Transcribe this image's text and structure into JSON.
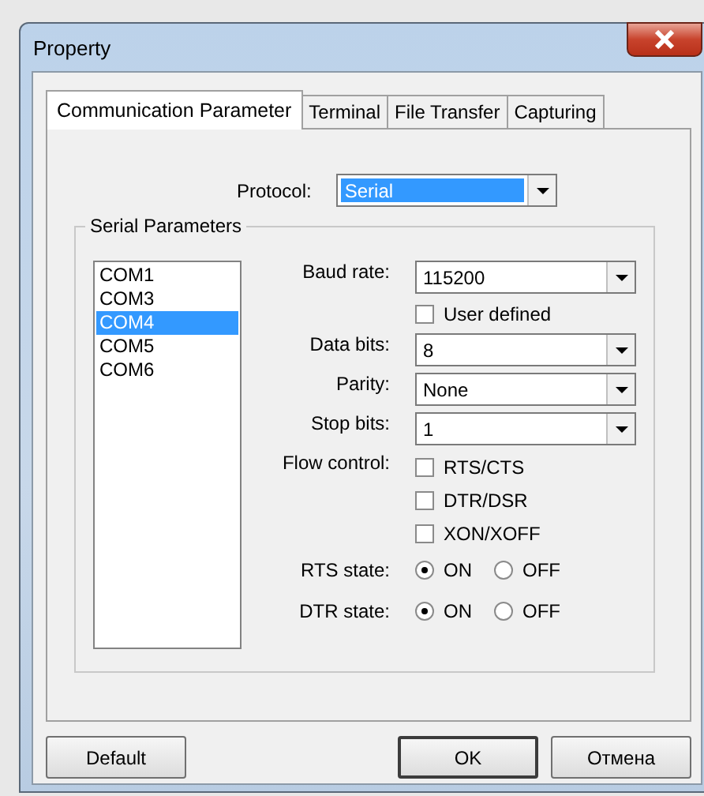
{
  "window": {
    "title": "Property"
  },
  "tabs": [
    {
      "label": "Communication Parameter",
      "selected": true
    },
    {
      "label": "Terminal",
      "selected": false
    },
    {
      "label": "File Transfer",
      "selected": false
    },
    {
      "label": "Capturing",
      "selected": false
    }
  ],
  "protocol": {
    "label": "Protocol:",
    "value": "Serial"
  },
  "serial_parameters": {
    "title": "Serial Parameters",
    "ports": [
      {
        "name": "COM1",
        "selected": false
      },
      {
        "name": "COM3",
        "selected": false
      },
      {
        "name": "COM4",
        "selected": true
      },
      {
        "name": "COM5",
        "selected": false
      },
      {
        "name": "COM6",
        "selected": false
      }
    ],
    "baud_rate": {
      "label": "Baud rate:",
      "value": "115200"
    },
    "user_defined": {
      "label": "User defined",
      "checked": false
    },
    "data_bits": {
      "label": "Data bits:",
      "value": "8"
    },
    "parity": {
      "label": "Parity:",
      "value": "None"
    },
    "stop_bits": {
      "label": "Stop bits:",
      "value": "1"
    },
    "flow_control": {
      "label": "Flow control:",
      "options": [
        {
          "label": "RTS/CTS",
          "checked": false
        },
        {
          "label": "DTR/DSR",
          "checked": false
        },
        {
          "label": "XON/XOFF",
          "checked": false
        }
      ]
    },
    "rts_state": {
      "label": "RTS state:",
      "options": [
        {
          "label": "ON",
          "selected": true
        },
        {
          "label": "OFF",
          "selected": false
        }
      ]
    },
    "dtr_state": {
      "label": "DTR state:",
      "options": [
        {
          "label": "ON",
          "selected": true
        },
        {
          "label": "OFF",
          "selected": false
        }
      ]
    }
  },
  "buttons": [
    {
      "label": "Default",
      "default": false
    },
    {
      "label": "OK",
      "default": true
    },
    {
      "label": "Отмена",
      "default": false
    }
  ]
}
